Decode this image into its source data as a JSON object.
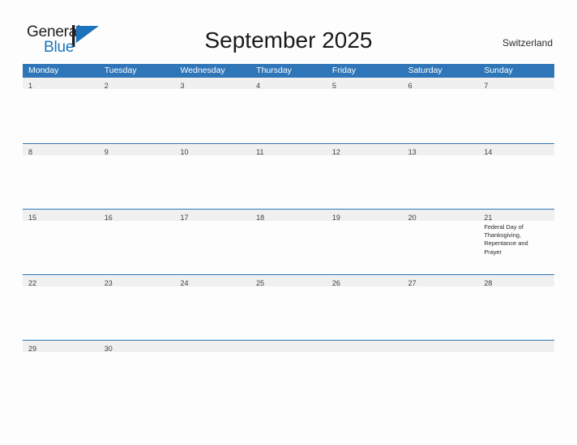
{
  "brand": {
    "word_one": "General",
    "word_two": "Blue",
    "flag_icon": "blue-pennant-flag-icon",
    "accent_color": "#1b74bb",
    "text_color": "#231f20"
  },
  "header": {
    "title": "September 2025",
    "country": "Switzerland"
  },
  "theme": {
    "header_blue": "#2e76b8",
    "date_band_gray": "#f0f0f0",
    "page_background": "#fdfdfd",
    "date_text": "#404040",
    "event_text": "#2b2b2b"
  },
  "calendar": {
    "month": "September",
    "year": "2025",
    "weekday_headers": [
      "Monday",
      "Tuesday",
      "Wednesday",
      "Thursday",
      "Friday",
      "Saturday",
      "Sunday"
    ],
    "weeks": [
      {
        "days": [
          {
            "num": "1",
            "event": ""
          },
          {
            "num": "2",
            "event": ""
          },
          {
            "num": "3",
            "event": ""
          },
          {
            "num": "4",
            "event": ""
          },
          {
            "num": "5",
            "event": ""
          },
          {
            "num": "6",
            "event": ""
          },
          {
            "num": "7",
            "event": ""
          }
        ]
      },
      {
        "days": [
          {
            "num": "8",
            "event": ""
          },
          {
            "num": "9",
            "event": ""
          },
          {
            "num": "10",
            "event": ""
          },
          {
            "num": "11",
            "event": ""
          },
          {
            "num": "12",
            "event": ""
          },
          {
            "num": "13",
            "event": ""
          },
          {
            "num": "14",
            "event": ""
          }
        ]
      },
      {
        "days": [
          {
            "num": "15",
            "event": ""
          },
          {
            "num": "16",
            "event": ""
          },
          {
            "num": "17",
            "event": ""
          },
          {
            "num": "18",
            "event": ""
          },
          {
            "num": "19",
            "event": ""
          },
          {
            "num": "20",
            "event": ""
          },
          {
            "num": "21",
            "event": "Federal Day of Thanksgiving, Repentance and Prayer"
          }
        ]
      },
      {
        "days": [
          {
            "num": "22",
            "event": ""
          },
          {
            "num": "23",
            "event": ""
          },
          {
            "num": "24",
            "event": ""
          },
          {
            "num": "25",
            "event": ""
          },
          {
            "num": "26",
            "event": ""
          },
          {
            "num": "27",
            "event": ""
          },
          {
            "num": "28",
            "event": ""
          }
        ]
      },
      {
        "days": [
          {
            "num": "29",
            "event": ""
          },
          {
            "num": "30",
            "event": ""
          },
          {
            "num": "",
            "event": ""
          },
          {
            "num": "",
            "event": ""
          },
          {
            "num": "",
            "event": ""
          },
          {
            "num": "",
            "event": ""
          },
          {
            "num": "",
            "event": ""
          }
        ]
      }
    ]
  }
}
